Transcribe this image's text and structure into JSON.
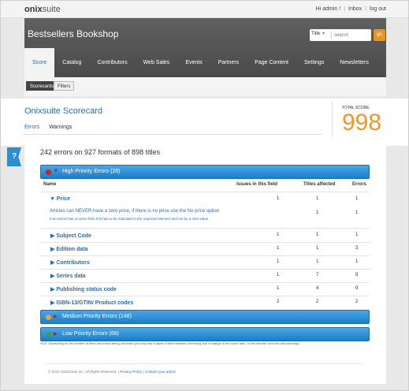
{
  "app": {
    "logo_bold": "onix",
    "logo_rest": "suite"
  },
  "toplinks": [
    "Hi admin !",
    "Inbox",
    "log out"
  ],
  "header": {
    "brand": "Bestsellers Bookshop",
    "search_select": "Title",
    "search_placeholder": "search",
    "go": "go"
  },
  "nav": [
    "Score",
    "Catalog",
    "Contributors",
    "Web Sales",
    "Events",
    "Partners",
    "Page Content",
    "Settings",
    "Newsletters"
  ],
  "subnav": [
    "Scorecards",
    "Filters"
  ],
  "scorecard": {
    "title": "Onixsuite Scorecard",
    "tabs": [
      "Errors",
      "Warnings"
    ],
    "total_label": "TOTAL SCORE",
    "total_value": "998"
  },
  "help": "?",
  "summary": "242 errors on 927 formats of 898 titles",
  "groups": [
    {
      "label": "High Priority Errors (26)",
      "color": "#d11e1e"
    },
    {
      "label": "Medium Priority Errors (148)",
      "color": "#f0a030"
    },
    {
      "label": "Low Priority Errors (68)",
      "color": "#3aa63a"
    }
  ],
  "table": {
    "headers": [
      "Name",
      "Issues in this field",
      "Titles affected",
      "Errors"
    ],
    "price": {
      "name": "▼ Price",
      "issues": "1",
      "titles": "1",
      "errors": "1",
      "msg": "Articles can NEVER have a zero price, if there is no price use the No price option",
      "note": "If an article has no price then this has to be indicated in the unpriced element and not by a zero value.",
      "msg_titles": "1",
      "msg_errors": "1"
    },
    "rows": [
      {
        "name": "▶ Subject Code",
        "issues": "1",
        "titles": "1",
        "errors": "1"
      },
      {
        "name": "▶ Edition data",
        "issues": "1",
        "titles": "1",
        "errors": "3"
      },
      {
        "name": "▶ Contributors",
        "issues": "1",
        "titles": "1",
        "errors": "1"
      },
      {
        "name": "▶ Series data",
        "issues": "1",
        "titles": "7",
        "errors": "9"
      },
      {
        "name": "▶ Publishing status code",
        "issues": "1",
        "titles": "4",
        "errors": "9"
      },
      {
        "name": "▶ ISBN-13/GTIN/ Product codes",
        "issues": "2",
        "titles": "2",
        "errors": "2"
      }
    ]
  },
  "footnote": "*N.B. Depending on the number of titles and errors being corrected you may see a lapse of time between correcting and a change in the score and / or the number of errors and warnings.",
  "footer": {
    "copyright": "© 2014 GiantChair Inc. All Rights Reserved.",
    "privacy": "Privacy Policy",
    "contact": "Contact your admin"
  }
}
